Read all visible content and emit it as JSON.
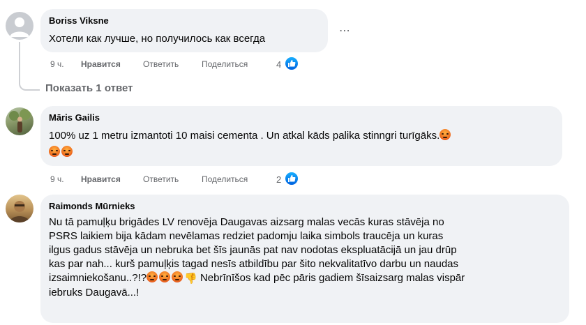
{
  "comments": [
    {
      "author": "Boriss Viksne",
      "text": "Хотели как лучше, но получилось как всегда",
      "time": "9 ч.",
      "like_label": "Нравится",
      "reply_label": "Ответить",
      "share_label": "Поделиться",
      "reaction_count": "4",
      "more_icon": "⋯"
    },
    {
      "author": "Māris Gailis",
      "text_line1": "100% uz 1 metru izmantoti 10 maisi cementa . Un atkal kāds palika stinngri turīgāks.",
      "time": "9 ч.",
      "like_label": "Нравится",
      "reply_label": "Ответить",
      "share_label": "Поделиться",
      "reaction_count": "2"
    },
    {
      "author": "Raimonds Mūrnieks",
      "lines": [
        "Nu tā pamuļķu brigādes LV renovēja Daugavas aizsarg malas vecās kuras stāvēja no",
        "PSRS laikiem bija kādam nevēlamas redziet padomju laika simbols traucēja un kuras",
        "ilgus gadus stāvēja un nebruka bet šīs jaunās pat nav nodotas ekspluatācijā un jau drūp",
        "kas par nah... kurš pamuļķis tagad nesīs atbildību par šito nekvalitatīvo darbu un naudas"
      ],
      "line5_start": "izsaimniekošanu..?!?",
      "line5_end": "Nebrīnīšos kad pēc pāris gadiem šīsaizsarg malas vispār",
      "line6": "iebruks Daugavā...!"
    }
  ],
  "show_replies": "Показать 1 ответ",
  "colors": {
    "bubble": "#f0f2f5",
    "meta": "#65676b",
    "like_blue": "#0866ff"
  }
}
